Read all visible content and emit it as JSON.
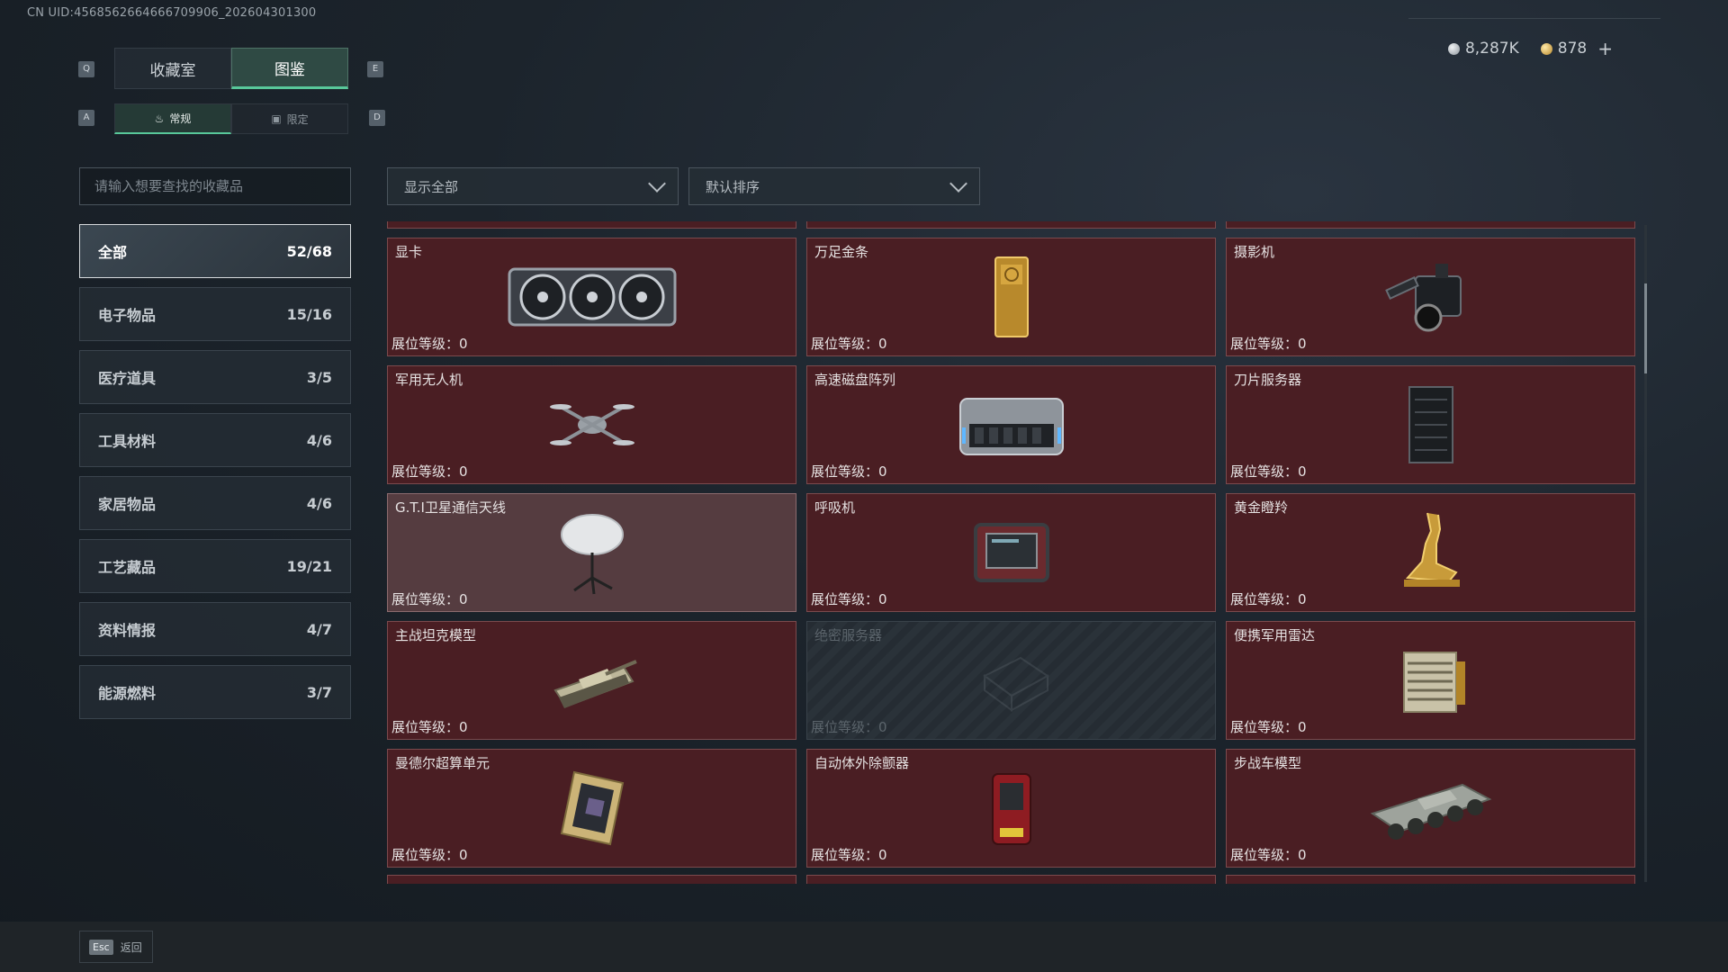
{
  "uid_text": "CN UID:4568562664666709906_202604301300",
  "currency": {
    "silver": "8,287K",
    "gold": "878",
    "plus": "+"
  },
  "keys": {
    "prev_tab": "Q",
    "next_tab": "E",
    "prev_sub": "A",
    "next_sub": "D"
  },
  "tabs": [
    {
      "label": "收藏室",
      "active": false
    },
    {
      "label": "图鉴",
      "active": true
    }
  ],
  "subtabs": [
    {
      "label": "常规",
      "icon": "flame-icon",
      "active": true
    },
    {
      "label": "限定",
      "icon": "frame-icon",
      "active": false
    }
  ],
  "search": {
    "placeholder": "请输入想要查找的收藏品"
  },
  "categories": [
    {
      "label": "全部",
      "count": "52/68",
      "active": true
    },
    {
      "label": "电子物品",
      "count": "15/16"
    },
    {
      "label": "医疗道具",
      "count": "3/5"
    },
    {
      "label": "工具材料",
      "count": "4/6"
    },
    {
      "label": "家居物品",
      "count": "4/6"
    },
    {
      "label": "工艺藏品",
      "count": "19/21"
    },
    {
      "label": "资料情报",
      "count": "4/7"
    },
    {
      "label": "能源燃料",
      "count": "3/7"
    }
  ],
  "filters": {
    "show": "显示全部",
    "sort": "默认排序"
  },
  "items": [
    {
      "name": "显卡",
      "level": "展位等级：0",
      "icon": "gpu-icon",
      "state": "normal"
    },
    {
      "name": "万足金条",
      "level": "展位等级：0",
      "icon": "gold-bar-icon",
      "state": "normal"
    },
    {
      "name": "摄影机",
      "level": "展位等级：0",
      "icon": "camera-icon",
      "state": "normal"
    },
    {
      "name": "军用无人机",
      "level": "展位等级：0",
      "icon": "drone-icon",
      "state": "normal"
    },
    {
      "name": "高速磁盘阵列",
      "level": "展位等级：0",
      "icon": "disk-array-icon",
      "state": "normal"
    },
    {
      "name": "刀片服务器",
      "level": "展位等级：0",
      "icon": "server-icon",
      "state": "normal"
    },
    {
      "name": "G.T.I卫星通信天线",
      "level": "展位等级：0",
      "icon": "satellite-dish-icon",
      "state": "highlighted"
    },
    {
      "name": "呼吸机",
      "level": "展位等级：0",
      "icon": "ventilator-icon",
      "state": "normal"
    },
    {
      "name": "黄金瞪羚",
      "level": "展位等级：0",
      "icon": "gold-gazelle-icon",
      "state": "normal"
    },
    {
      "name": "主战坦克模型",
      "level": "展位等级：0",
      "icon": "tank-icon",
      "state": "normal"
    },
    {
      "name": "绝密服务器",
      "level": "展位等级：0",
      "icon": "secret-server-icon",
      "state": "locked"
    },
    {
      "name": "便携军用雷达",
      "level": "展位等级：0",
      "icon": "radar-icon",
      "state": "normal"
    },
    {
      "name": "曼德尔超算单元",
      "level": "展位等级：0",
      "icon": "cpu-unit-icon",
      "state": "normal"
    },
    {
      "name": "自动体外除颤器",
      "level": "展位等级：0",
      "icon": "defibrillator-icon",
      "state": "normal"
    },
    {
      "name": "步战车模型",
      "level": "展位等级：0",
      "icon": "ifv-icon",
      "state": "normal"
    }
  ],
  "footer": {
    "esc_key": "Esc",
    "back_label": "返回"
  }
}
